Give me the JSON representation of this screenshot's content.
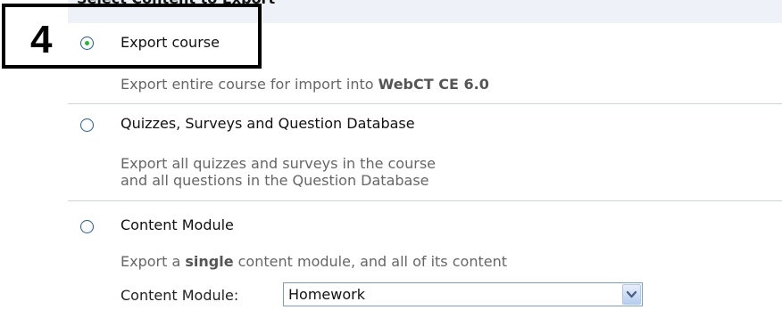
{
  "section": {
    "title": "Select Content to Export"
  },
  "callout": {
    "number": "4"
  },
  "options": [
    {
      "label": "Export course",
      "checked": true,
      "description_prefix": "Export entire course for import into ",
      "description_bold": "WebCT CE 6.0"
    },
    {
      "label": "Quizzes, Surveys and Question Database",
      "checked": false,
      "description_line1": "Export all quizzes and surveys in the course",
      "description_line2": "and all questions in the Question Database"
    },
    {
      "label": "Content Module",
      "checked": false,
      "description_prefix": "Export a ",
      "description_bold": "single",
      "description_suffix": " content module, and all of its content"
    }
  ],
  "content_module_select": {
    "label": "Content Module:",
    "selected_value": "Homework"
  },
  "colors": {
    "header_bg": "#eef1f7",
    "radio_dot": "#2db33a",
    "description_text": "#666666",
    "select_border": "#7f9db9"
  },
  "icons": {
    "dropdown": "chevron-down-icon"
  }
}
